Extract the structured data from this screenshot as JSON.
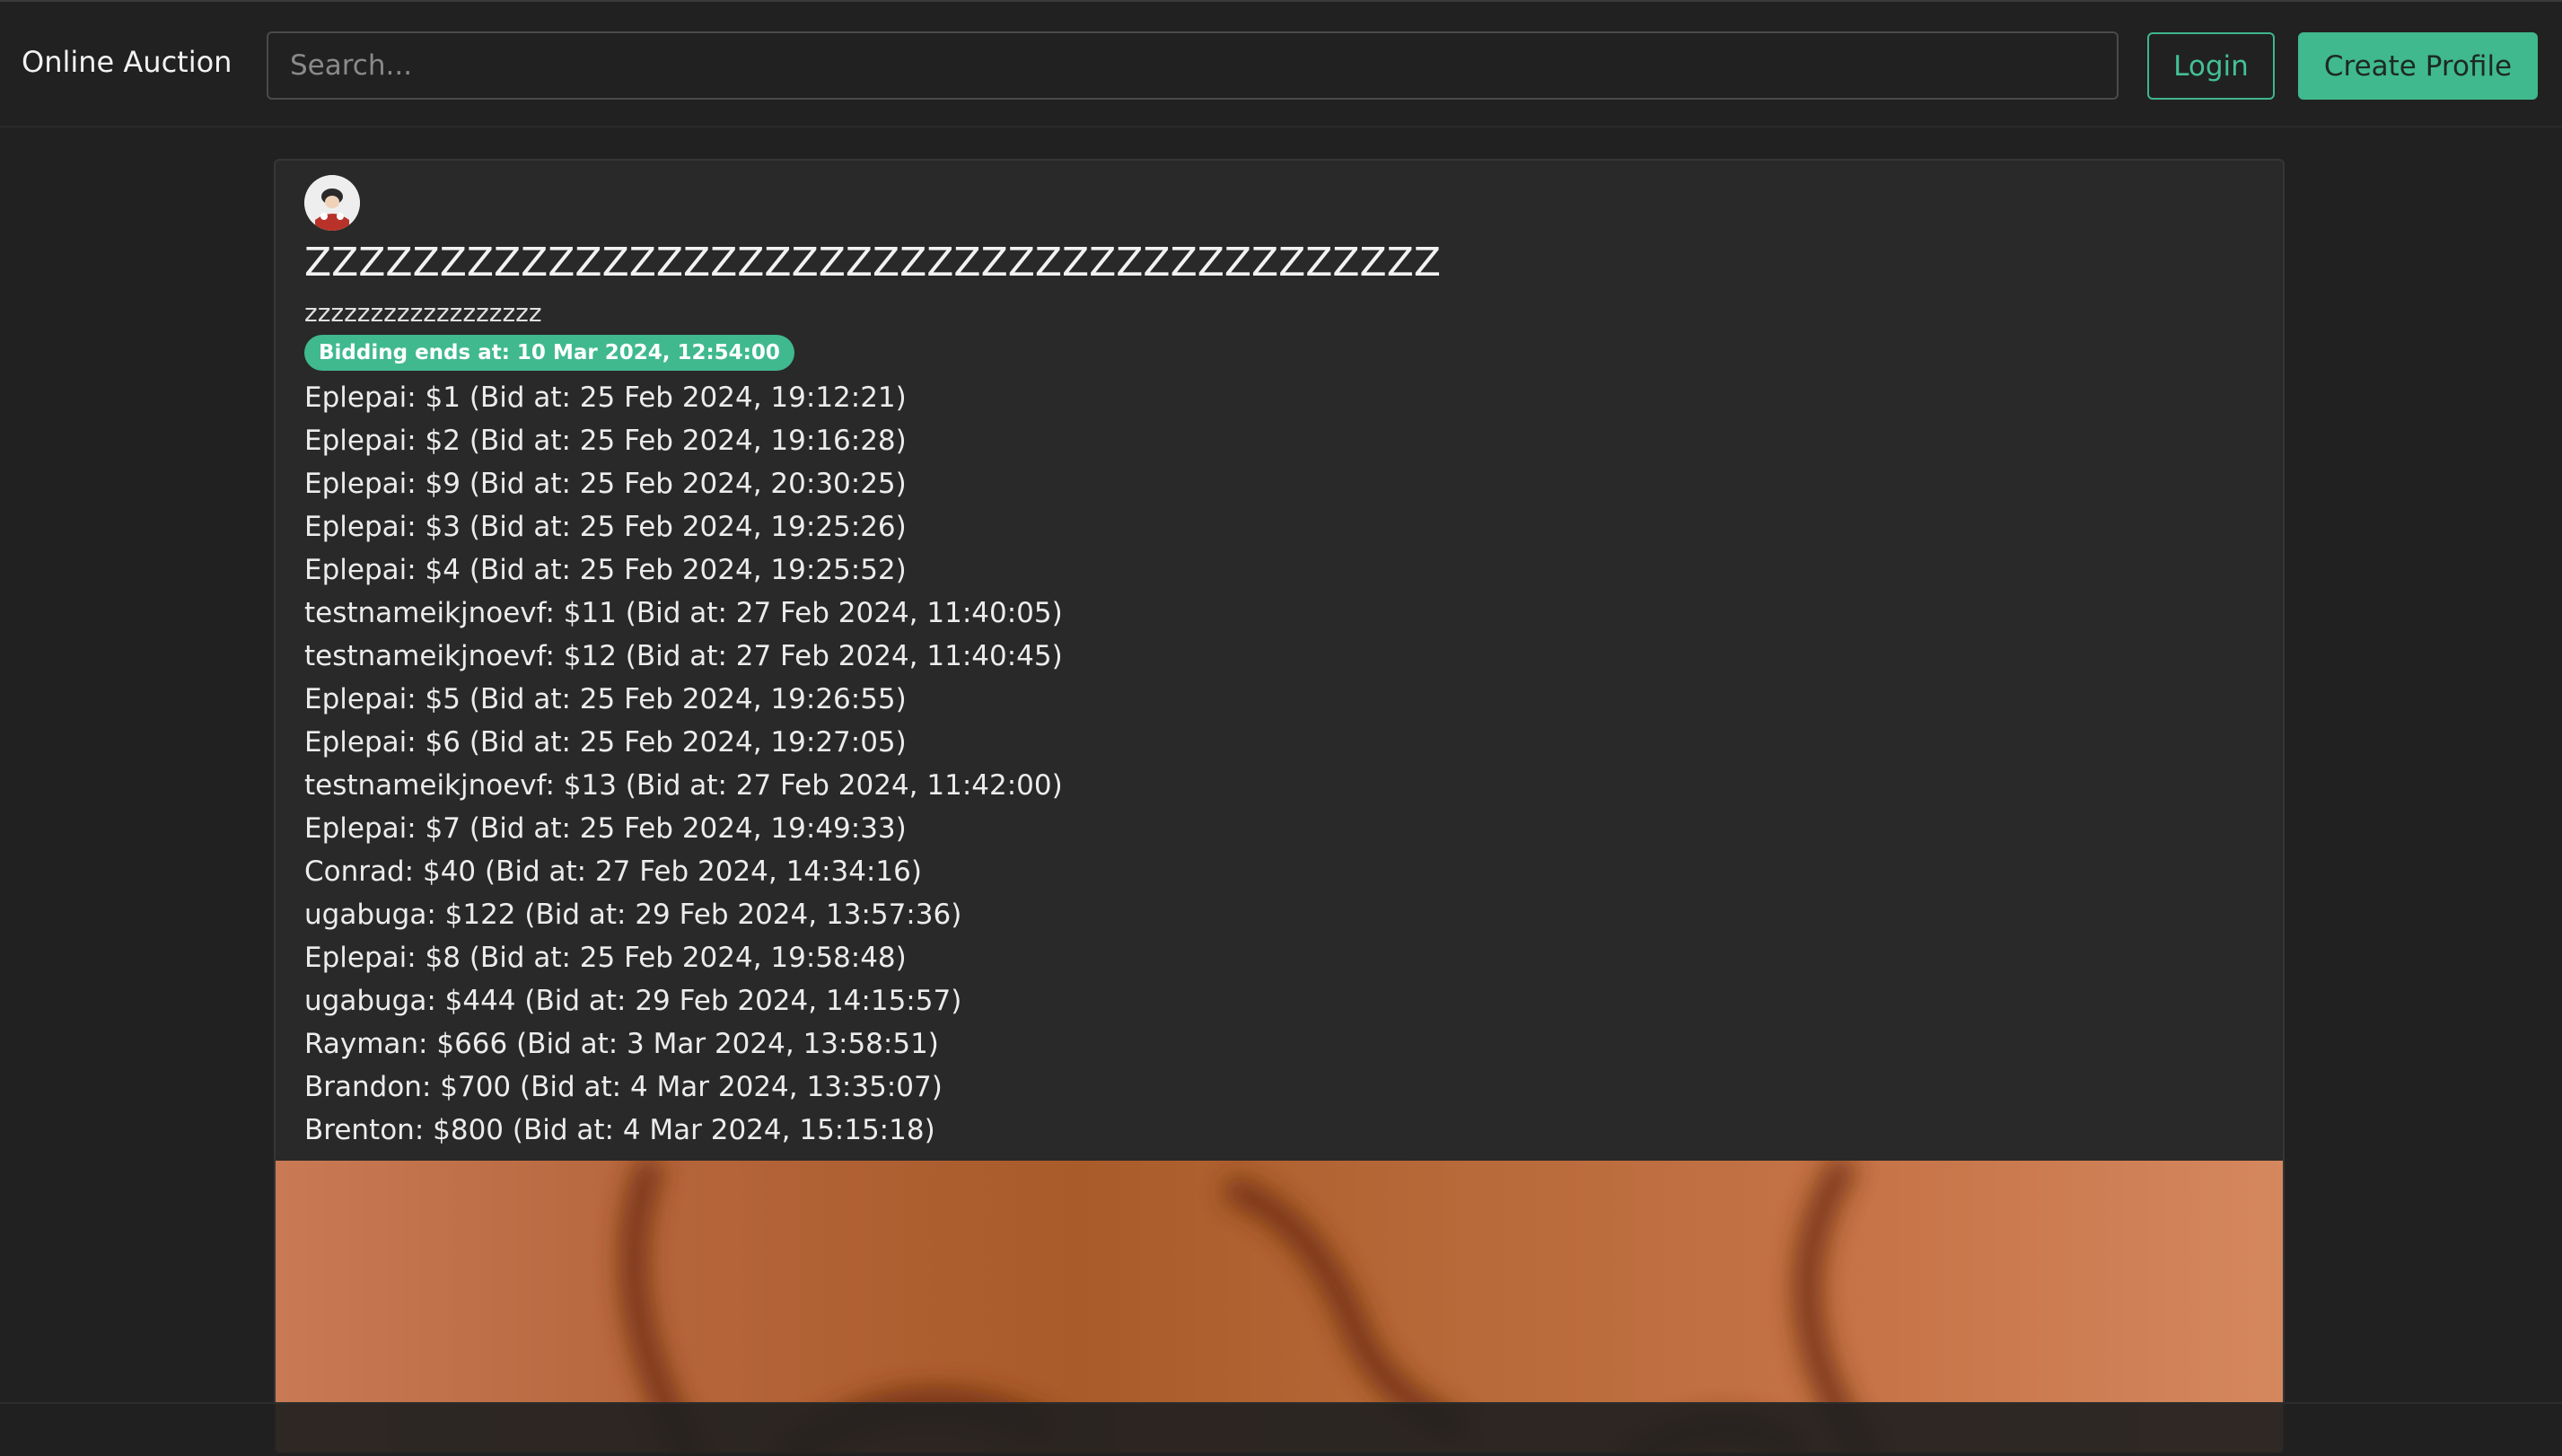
{
  "navbar": {
    "brand": "Online Auction",
    "search_placeholder": "Search...",
    "login_label": "Login",
    "create_profile_label": "Create Profile"
  },
  "listing": {
    "title": "ZZZZZZZZZZZZZZZZZZZZZZZZZZZZZZZZZZZZZZZZZZ",
    "description": "zzzzzzzzzzzzzzzzzz",
    "bidding_ends": "Bidding ends at: 10 Mar 2024, 12:54:00",
    "bids": [
      "Eplepai: $1 (Bid at: 25 Feb 2024, 19:12:21)",
      "Eplepai: $2 (Bid at: 25 Feb 2024, 19:16:28)",
      "Eplepai: $9 (Bid at: 25 Feb 2024, 20:30:25)",
      "Eplepai: $3 (Bid at: 25 Feb 2024, 19:25:26)",
      "Eplepai: $4 (Bid at: 25 Feb 2024, 19:25:52)",
      "testnameikjnoevf: $11 (Bid at: 27 Feb 2024, 11:40:05)",
      "testnameikjnoevf: $12 (Bid at: 27 Feb 2024, 11:40:45)",
      "Eplepai: $5 (Bid at: 25 Feb 2024, 19:26:55)",
      "Eplepai: $6 (Bid at: 25 Feb 2024, 19:27:05)",
      "testnameikjnoevf: $13 (Bid at: 27 Feb 2024, 11:42:00)",
      "Eplepai: $7 (Bid at: 25 Feb 2024, 19:49:33)",
      "Conrad: $40 (Bid at: 27 Feb 2024, 14:34:16)",
      "ugabuga: $122 (Bid at: 29 Feb 2024, 13:57:36)",
      "Eplepai: $8 (Bid at: 25 Feb 2024, 19:58:48)",
      "ugabuga: $444 (Bid at: 29 Feb 2024, 14:15:57)",
      "Rayman: $666 (Bid at: 3 Mar 2024, 13:58:51)",
      "Brandon: $700 (Bid at: 4 Mar 2024, 13:35:07)",
      "Brenton: $800 (Bid at: 4 Mar 2024, 15:15:18)"
    ]
  },
  "colors": {
    "background": "#212121",
    "card": "#292929",
    "accent": "#40b98f"
  }
}
